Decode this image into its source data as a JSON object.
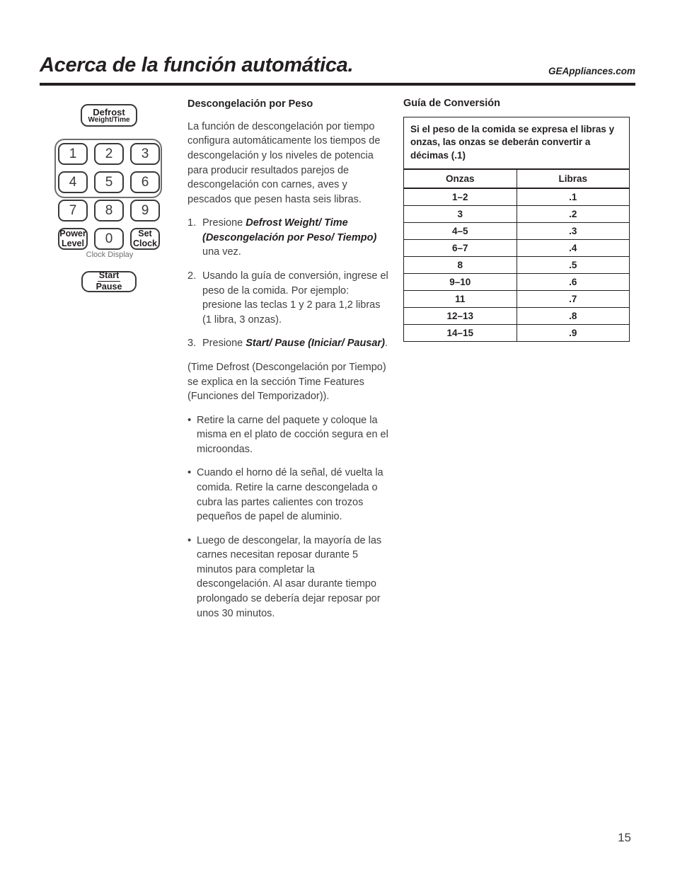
{
  "header": {
    "title": "Acerca de la función automática.",
    "site_url": "GEAppliances.com"
  },
  "keypad": {
    "defrost_line1": "Defrost",
    "defrost_line2": "Weight/Time",
    "keys": [
      "1",
      "2",
      "3",
      "4",
      "5",
      "6",
      "7",
      "8",
      "9"
    ],
    "zero_key": "0",
    "power_level_line1": "Power",
    "power_level_line2": "Level",
    "set_clock_line1": "Set",
    "set_clock_line2": "Clock",
    "clock_display_label": "Clock Display",
    "start_line1": "Start",
    "start_line2": "Pause"
  },
  "main": {
    "section_heading": "Descongelación por Peso",
    "intro": "La función de descongelación por tiempo configura automáticamente los tiempos de descongelación y los niveles de potencia para producir resultados parejos de descongelación con carnes, aves y pescados que pesen hasta seis libras.",
    "steps": [
      {
        "marker": "1.",
        "pre": "Presione ",
        "emphasis": "Defrost Weight/ Time (Descongelación por Peso/ Tiempo)",
        "post": " una vez."
      },
      {
        "marker": "2.",
        "pre": "Usando la guía de conversión, ingrese el peso de la comida. Por ejemplo: presione las teclas 1 y 2 para 1,2 libras (1 libra, 3 onzas).",
        "emphasis": "",
        "post": ""
      },
      {
        "marker": "3.",
        "pre": "Presione ",
        "emphasis": "Start/ Pause (Iniciar/ Pausar)",
        "post": "."
      }
    ],
    "note": "(Time Defrost (Descongelación por Tiempo) se explica en la sección Time Features (Funciones del Temporizador)).",
    "bullets": [
      "Retire la carne del paquete y coloque la misma en el plato de cocción segura en el microondas.",
      "Cuando el horno dé la señal, dé vuelta la comida. Retire la carne descongelada o cubra las partes calientes con trozos pequeños de papel de aluminio.",
      "Luego de descongelar, la mayoría de las carnes necesitan reposar durante 5 minutos para completar la descongelación. Al asar durante tiempo prolongado se debería dejar reposar por unos 30 minutos."
    ],
    "bullet_marker": "•"
  },
  "conversion": {
    "caption": "Guía de Conversión",
    "intro": "Si el peso de la comida se expresa el libras y onzas, las onzas se deberán convertir a décimas (.1)",
    "columns": [
      "Onzas",
      "Libras"
    ],
    "rows": [
      [
        "1–2",
        ".1"
      ],
      [
        "3",
        ".2"
      ],
      [
        "4–5",
        ".3"
      ],
      [
        "6–7",
        ".4"
      ],
      [
        "8",
        ".5"
      ],
      [
        "9–10",
        ".6"
      ],
      [
        "11",
        ".7"
      ],
      [
        "12–13",
        ".8"
      ],
      [
        "14–15",
        ".9"
      ]
    ]
  },
  "footer": {
    "page_number": "15"
  }
}
